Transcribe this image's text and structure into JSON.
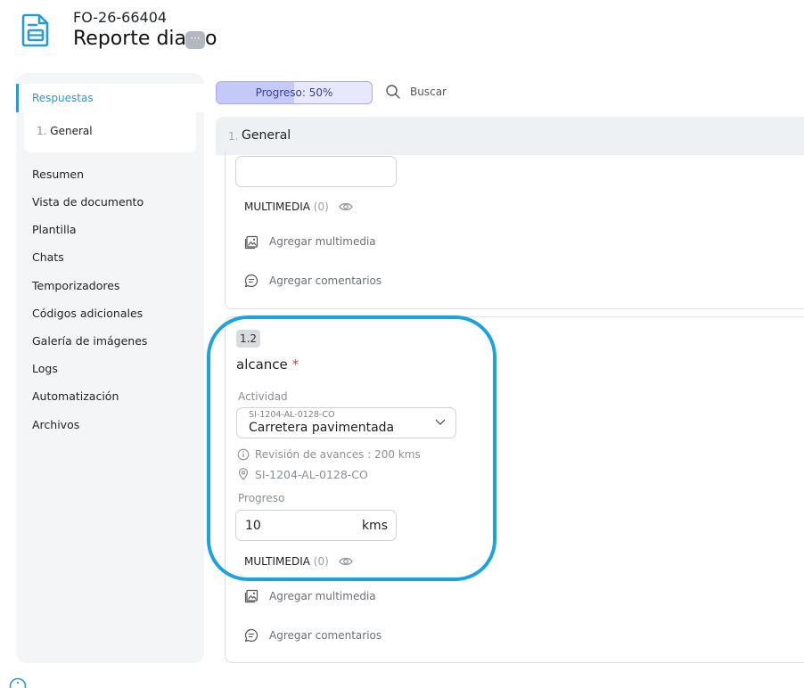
{
  "header": {
    "code": "FO-26-66404",
    "title": "Reporte dia",
    "title_tail": "o",
    "ellipsis": "···",
    "icon": "document-icon"
  },
  "sidebar": {
    "active": "Respuestas",
    "sub_num": "1.",
    "sub_label": "General",
    "items": [
      "Resumen",
      "Vista de documento",
      "Plantilla",
      "Chats",
      "Temporizadores",
      "Códigos adicionales",
      "Galería de imágenes",
      "Logs",
      "Automatización",
      "Archivos"
    ]
  },
  "toolbar": {
    "progress_label": "Progreso: 50%",
    "progress_value": 0.5,
    "search_label": "Buscar"
  },
  "section": {
    "num": "1.",
    "title": "General"
  },
  "card1": {
    "multimedia_label": "MULTIMEDIA",
    "multimedia_count": "(0)",
    "add_media": "Agregar multimedia",
    "add_comments": "Agregar comentarios"
  },
  "card2": {
    "number": "1.2",
    "title": "alcance",
    "required_mark": "*",
    "activity_label": "Actividad",
    "activity_code": "SI-1204-AL-0128-CO",
    "activity_value": "Carretera pavimentada",
    "info_text": "Revisión de avances : 200 kms",
    "location_text": "SI-1204-AL-0128-CO",
    "progress_label": "Progreso",
    "progress_value": "10",
    "progress_unit": "kms",
    "multimedia_label": "MULTIMEDIA",
    "multimedia_count": "(0)",
    "add_media": "Agregar multimedia",
    "add_comments": "Agregar comentarios"
  },
  "colors": {
    "accent": "#2a9ad3",
    "highlight": "#1ca3df",
    "progress_fill": "#c5c9f8",
    "required": "#e23b3b"
  }
}
